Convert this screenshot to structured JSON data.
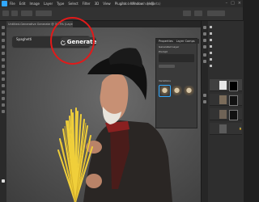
{
  "window": {
    "title": "Adobe Photoshop (Beta)",
    "menus": [
      "File",
      "Edit",
      "Image",
      "Layer",
      "Type",
      "Select",
      "Filter",
      "3D",
      "View",
      "Plugins",
      "Window",
      "Help"
    ]
  },
  "document_tab": {
    "label": "Untitled-Generative Generate @ 33.3% (Layer 1, RGB/8)"
  },
  "context_bar": {
    "prompt_value": "Spaghetti",
    "generate_label": "Generate"
  },
  "properties_panel": {
    "tabs": [
      "Properties",
      "Layer Comps"
    ],
    "section_label": "Generated Layer",
    "prompt_label": "Prompt",
    "variations_label": "Variations"
  },
  "colors": {
    "accent": "#31a8ff",
    "highlight_circle": "#e11a1a",
    "pasta": "#f0cf3a"
  },
  "icons": [
    "photoshop-app-icon",
    "sparkle-icon",
    "eye-icon",
    "lock-icon"
  ]
}
